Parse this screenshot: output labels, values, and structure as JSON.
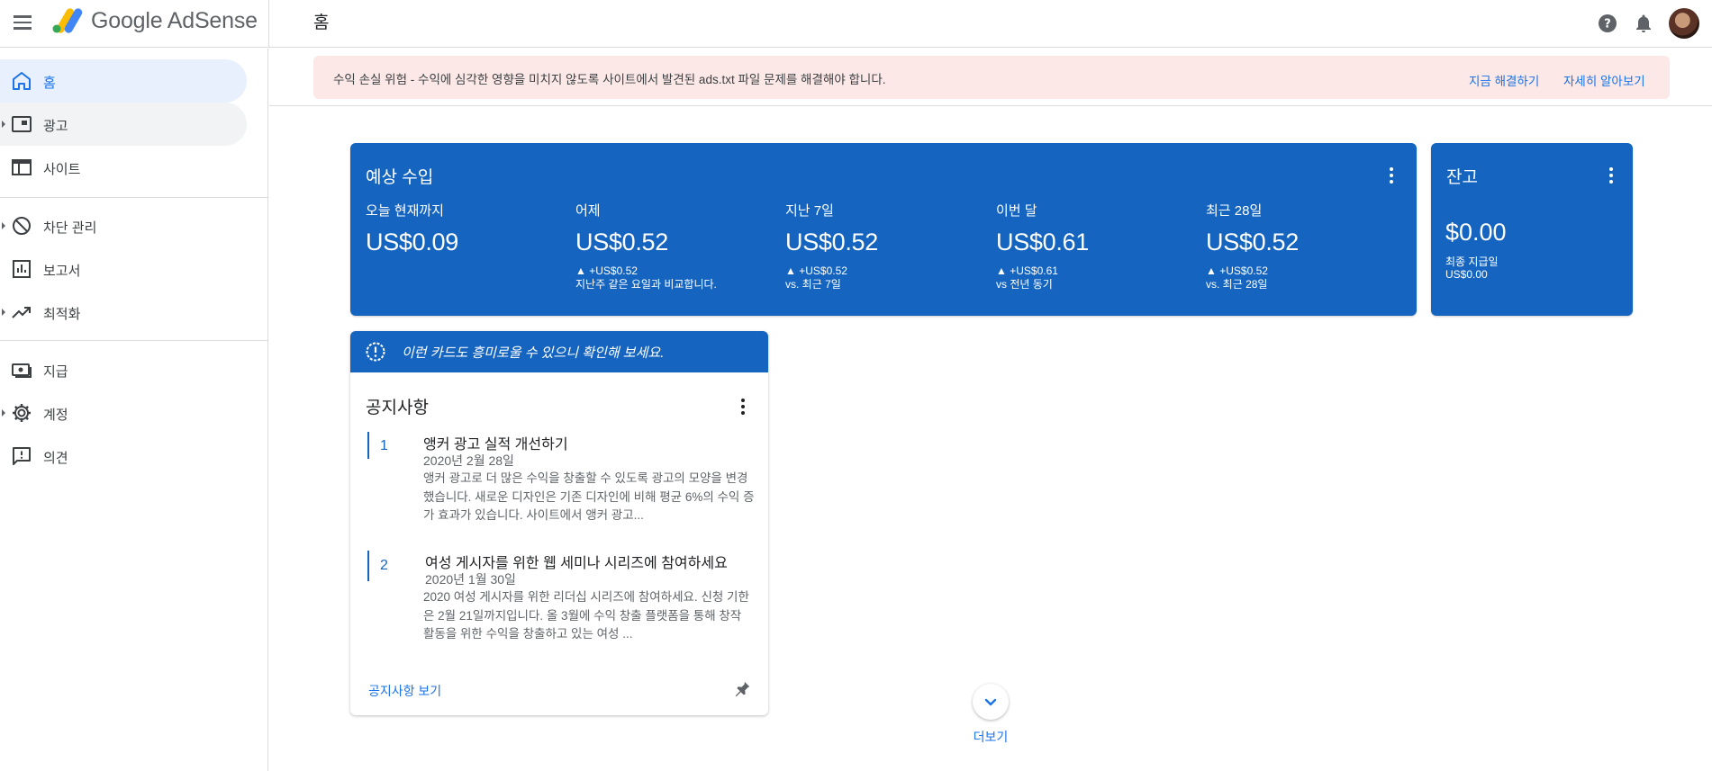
{
  "app": {
    "brand": "Google AdSense",
    "page_title": "홈"
  },
  "colors": {
    "primary_card": "#1565c0",
    "accent": "#1a73e8",
    "alert_bg": "#fce8e6",
    "active_nav": "#e8f0fe"
  },
  "sidebar": {
    "items": [
      {
        "label": "홈",
        "icon": "home-icon"
      },
      {
        "label": "광고",
        "icon": "ads-icon"
      },
      {
        "label": "사이트",
        "icon": "sites-icon"
      },
      {
        "label": "차단 관리",
        "icon": "block-icon"
      },
      {
        "label": "보고서",
        "icon": "reports-icon"
      },
      {
        "label": "최적화",
        "icon": "trending-up-icon"
      },
      {
        "label": "지급",
        "icon": "payments-icon"
      },
      {
        "label": "계정",
        "icon": "gear-icon"
      },
      {
        "label": "의견",
        "icon": "feedback-icon"
      }
    ]
  },
  "alert": {
    "text": "수익 손실 위험 - 수익에 심각한 영향을 미치지 않도록 사이트에서 발견된 ads.txt 파일 문제를 해결해야 합니다.",
    "fix_link": "지금 해결하기",
    "learn_link": "자세히 알아보기"
  },
  "earnings": {
    "title": "예상 수입",
    "metrics": [
      {
        "label": "오늘 현재까지",
        "value": "US$0.09",
        "delta": "",
        "compare": ""
      },
      {
        "label": "어제",
        "value": "US$0.52",
        "delta": "▲ +US$0.52",
        "compare": "지난주 같은 요일과 비교합니다."
      },
      {
        "label": "지난 7일",
        "value": "US$0.52",
        "delta": "▲ +US$0.52",
        "compare": "vs. 최근 7일"
      },
      {
        "label": "이번 달",
        "value": "US$0.61",
        "delta": "▲ +US$0.61",
        "compare": "vs 전년 동기"
      },
      {
        "label": "최근 28일",
        "value": "US$0.52",
        "delta": "▲ +US$0.52",
        "compare": "vs. 최근 28일"
      }
    ]
  },
  "balance": {
    "title": "잔고",
    "value": "$0.00",
    "last_payment_label": "최종 지급일",
    "last_payment_value": "US$0.00"
  },
  "notice_card": {
    "banner_text": "이런 카드도 흥미로울 수 있으니 확인해 보세요.",
    "title": "공지사항",
    "announcements": [
      {
        "num": "1",
        "title": "앵커 광고 실적 개선하기",
        "date": "2020년 2월 28일",
        "body": "앵커 광고로 더 많은 수익을 창출할 수 있도록 광고의 모양을 변경했습니다. 새로운 디자인은 기존 디자인에 비해 평균 6%의 수익 증가 효과가 있습니다. 사이트에서 앵커 광고..."
      },
      {
        "num": "2",
        "title": "여성 게시자를 위한 웹 세미나 시리즈에 참여하세요",
        "date": "2020년 1월 30일",
        "body": "2020 여성 게시자를 위한 리더십 시리즈에 참여하세요. 신청 기한은 2월 21일까지입니다. 올 3월에 수익 창출 플랫폼을 통해 창작 활동을 위한 수익을 창출하고 있는 여성 ..."
      }
    ],
    "view_link": "공지사항 보기"
  },
  "more": {
    "label": "더보기"
  }
}
